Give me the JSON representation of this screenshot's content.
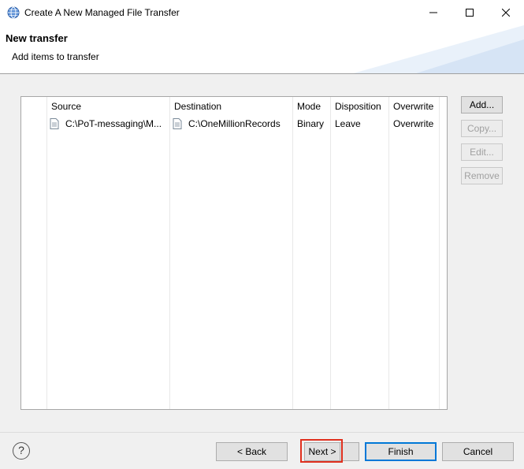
{
  "window": {
    "title": "Create A New Managed File Transfer"
  },
  "header": {
    "title": "New transfer",
    "subtitle": "Add items to transfer"
  },
  "table": {
    "columns": [
      "Source",
      "Destination",
      "Mode",
      "Disposition",
      "Overwrite"
    ],
    "rows": [
      {
        "source": "C:\\PoT-messaging\\M...",
        "destination": "C:\\OneMillionRecords",
        "mode": "Binary",
        "disposition": "Leave",
        "overwrite": "Overwrite"
      }
    ]
  },
  "side_buttons": {
    "add": "Add...",
    "copy": "Copy...",
    "edit": "Edit...",
    "remove": "Remove"
  },
  "footer": {
    "help": "?",
    "back": "< Back",
    "next": "Next >",
    "finish": "Finish",
    "cancel": "Cancel"
  },
  "colors": {
    "highlight": "#e0301e",
    "default_button_border": "#0078d7"
  }
}
